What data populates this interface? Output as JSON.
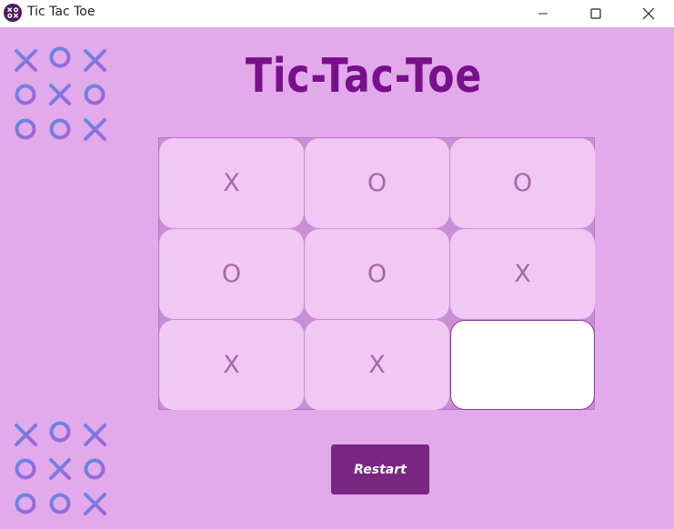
{
  "window": {
    "title": "Tic Tac Toe",
    "icon": "tictactoe-app-icon",
    "controls": [
      "minimize",
      "maximize",
      "close"
    ]
  },
  "game": {
    "title": "Tic-Tac-Toe",
    "board": [
      [
        "X",
        "O",
        "O"
      ],
      [
        "O",
        "O",
        "X"
      ],
      [
        "X",
        "X",
        ""
      ]
    ],
    "restart_label": "Restart"
  },
  "colors": {
    "background": "#e2aaeb",
    "title": "#7a0f8c",
    "cell": "#efc9f3",
    "cell_mark": "#a866a8",
    "restart_button": "#7a2683"
  }
}
